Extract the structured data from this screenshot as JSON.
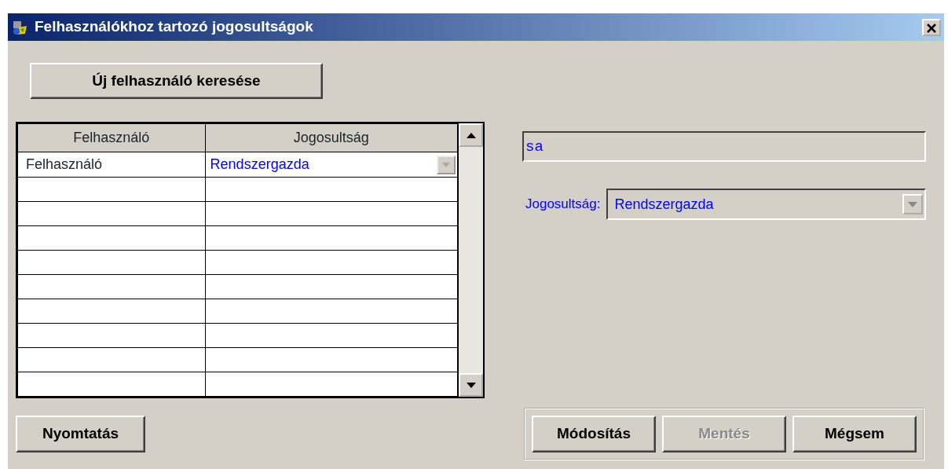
{
  "window": {
    "title": "Felhasználókhoz tartozó jogosultságok"
  },
  "search_button": {
    "label": "Új felhasználó keresése"
  },
  "grid": {
    "columns": [
      "Felhasználó",
      "Jogosultság"
    ],
    "rows": [
      {
        "user": "Felhasználó",
        "role": "Rendszergazda"
      }
    ]
  },
  "detail": {
    "user_field": {
      "value": "sa"
    },
    "role_label": "Jogosultság:",
    "role_combo": {
      "value": "Rendszergazda"
    }
  },
  "print_button": {
    "label": "Nyomtatás",
    "disabled": false
  },
  "actions": [
    {
      "label": "Módosítás",
      "disabled": false
    },
    {
      "label": "Mentés",
      "disabled": true
    },
    {
      "label": "Mégsem",
      "disabled": false
    }
  ]
}
